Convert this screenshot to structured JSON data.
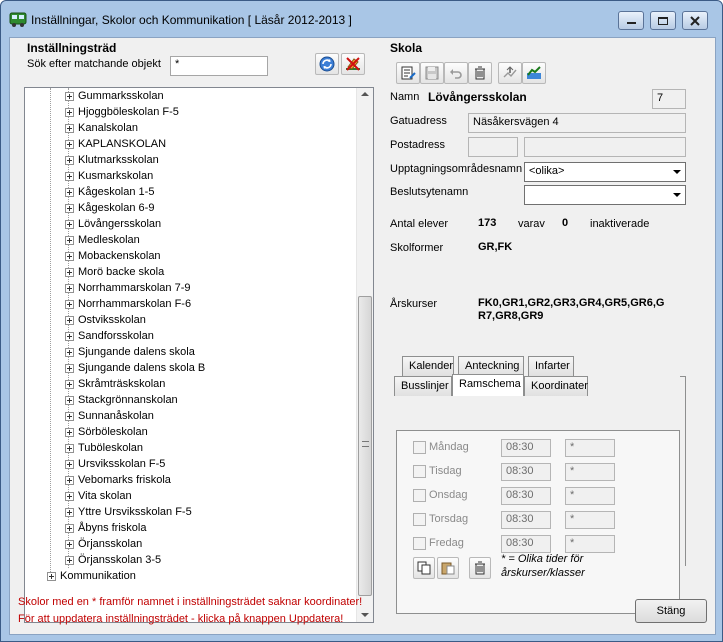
{
  "window": {
    "title": "Inställningar, Skolor och Kommunikation [ Läsår 2012-2013 ]",
    "min_icon": "minimize-icon",
    "max_icon": "maximize-icon",
    "close_icon": "close-icon"
  },
  "left": {
    "heading": "Inställningsträd",
    "search_label": "Sök efter matchande objekt",
    "search_value": "*",
    "tree_items": [
      "Gummarksskolan",
      "Hjoggböleskolan F-5",
      "Kanalskolan",
      "KAPLANSKOLAN",
      "Klutmarksskolan",
      "Kusmarkskolan",
      "Kågeskolan 1-5",
      "Kågeskolan 6-9",
      "Lövångersskolan",
      "Medleskolan",
      "Mobackenskolan",
      "Morö backe skola",
      "Norrhammarskolan 7-9",
      "Norrhammarskolan F-6",
      "Ostviksskolan",
      "Sandforsskolan",
      "Sjungande dalens skola",
      "Sjungande dalens skola B",
      "Skråmträskskolan",
      "Stackgrönnanskolan",
      "Sunnanåskolan",
      "Sörböleskolan",
      "Tuböleskolan",
      "Ursviksskolan F-5",
      "Vebomarks friskola",
      "Vita skolan",
      "Yttre Ursviksskolan F-5",
      "Åbyns friskola",
      "Örjansskolan",
      "Örjansskolan 3-5"
    ],
    "root_item": "Kommunikation"
  },
  "right": {
    "heading": "Skola",
    "namn_label": "Namn",
    "namn_value": "Lövångersskolan",
    "namn_number": "7",
    "gatuadress_label": "Gatuadress",
    "gatuadress_value": "Näsåkersvägen 4",
    "postadress_label": "Postadress",
    "postadress_zip": "",
    "postadress_city": "",
    "upptagning_label": "Upptagningsområdesnamn",
    "upptagning_value": "<olika>",
    "beslut_label": "Beslutsytenamn",
    "beslut_value": "",
    "elever_label": "Antal elever",
    "elever_value": "173",
    "varav_label": "varav",
    "varav_value": "0",
    "inaktiverade_label": "inaktiverade",
    "skolformer_label": "Skolformer",
    "skolformer_value": "GR,FK",
    "arskurser_label": "Årskurser",
    "arskurser_line1": "FK0,GR1,GR2,GR3,GR4,GR5,GR6,G",
    "arskurser_line2": "R7,GR8,GR9"
  },
  "tabs": {
    "row1": [
      "Kalender",
      "Anteckning",
      "Infarter"
    ],
    "row2": [
      "Busslinjer",
      "Ramschema",
      "Koordinater"
    ]
  },
  "schedule": {
    "days": [
      {
        "label": "Måndag",
        "time": "08:30",
        "star": "*"
      },
      {
        "label": "Tisdag",
        "time": "08:30",
        "star": "*"
      },
      {
        "label": "Onsdag",
        "time": "08:30",
        "star": "*"
      },
      {
        "label": "Torsdag",
        "time": "08:30",
        "star": "*"
      },
      {
        "label": "Fredag",
        "time": "08:30",
        "star": "*"
      }
    ],
    "note_line1": "* = Olika tider för",
    "note_line2": "årskurser/klasser"
  },
  "footer": {
    "line1": "Skolor med en * framför namnet i inställningsträdet saknar koordinater!",
    "line2": "För att uppdatera inställningsträdet - klicka på knappen Uppdatera!",
    "close_button": "Stäng"
  },
  "colors": {
    "title_bg": "#a9c6e6",
    "warning_text": "#c00000"
  }
}
